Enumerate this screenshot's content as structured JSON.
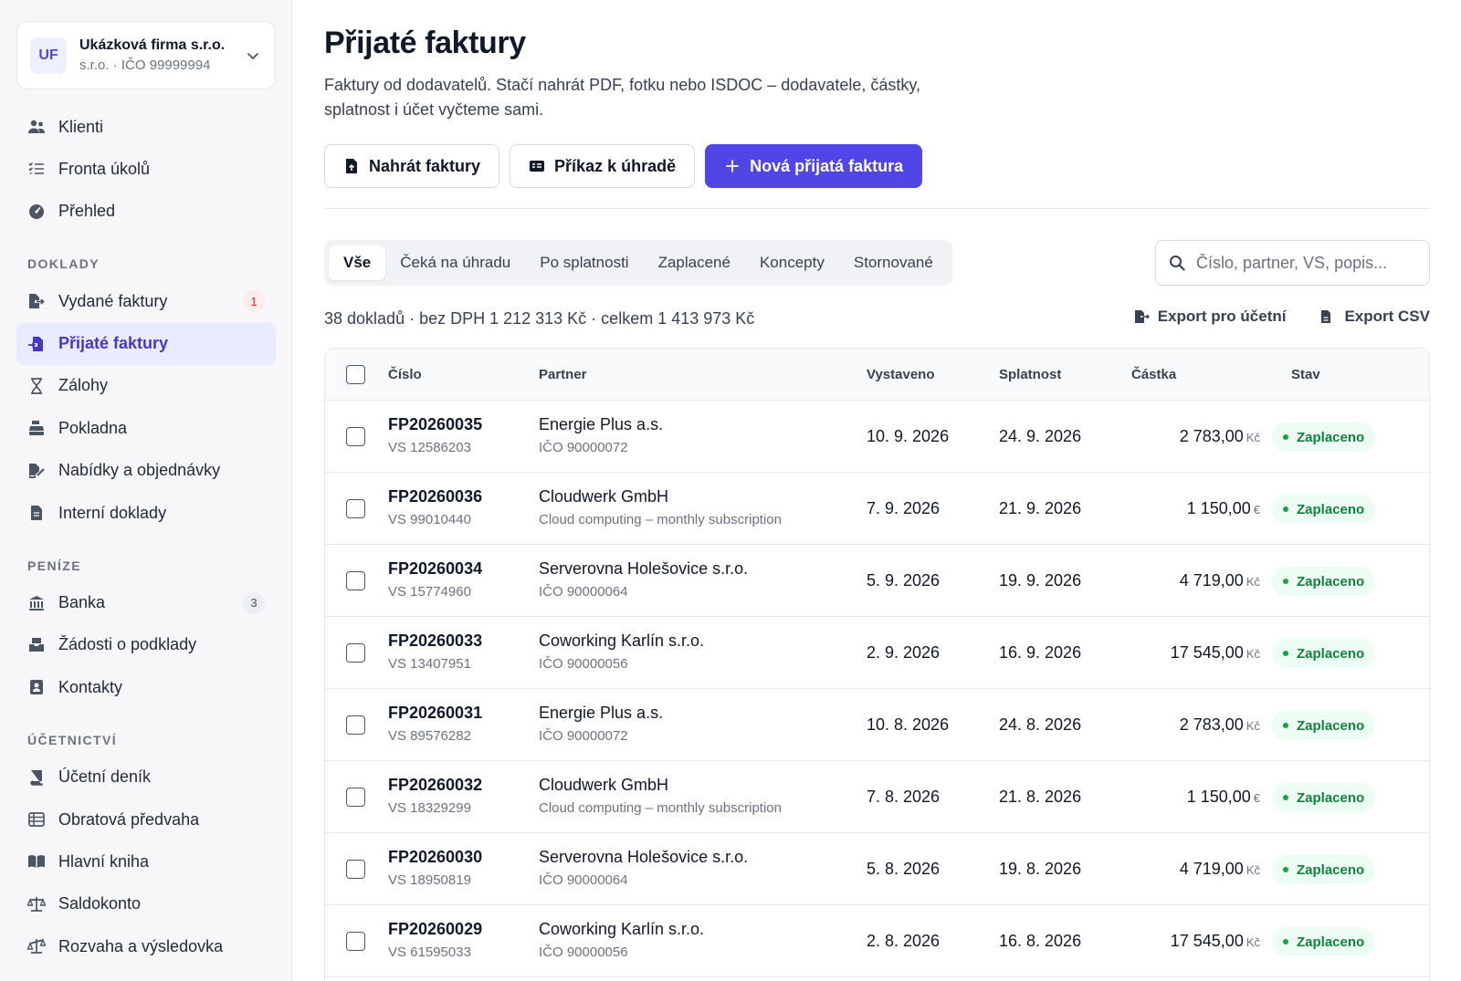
{
  "company": {
    "initials": "UF",
    "name": "Ukázková firma s.r.o.",
    "sub": "s.r.o. · IČO 99999994"
  },
  "nav": {
    "top": [
      {
        "label": "Klienti",
        "icon": "users-icon"
      },
      {
        "label": "Fronta úkolů",
        "icon": "task-list-icon"
      },
      {
        "label": "Přehled",
        "icon": "dashboard-gauge-icon"
      }
    ],
    "doklady_title": "DOKLADY",
    "doklady": [
      {
        "label": "Vydané faktury",
        "icon": "file-export-icon",
        "badge": "1"
      },
      {
        "label": "Přijaté faktury",
        "icon": "file-import-icon",
        "active": true
      },
      {
        "label": "Zálohy",
        "icon": "hourglass-icon"
      },
      {
        "label": "Pokladna",
        "icon": "cash-register-icon"
      },
      {
        "label": "Nabídky a objednávky",
        "icon": "file-signature-icon"
      },
      {
        "label": "Interní doklady",
        "icon": "file-icon"
      }
    ],
    "penize_title": "PENÍZE",
    "penize": [
      {
        "label": "Banka",
        "icon": "bank-icon",
        "badge": "3"
      },
      {
        "label": "Žádosti o podklady",
        "icon": "inbox-request-icon"
      },
      {
        "label": "Kontakty",
        "icon": "contact-card-icon"
      }
    ],
    "ucetnictvi_title": "ÚČETNICTVÍ",
    "ucetnictvi": [
      {
        "label": "Účetní deník",
        "icon": "journal-book-icon"
      },
      {
        "label": "Obratová předvaha",
        "icon": "table-list-icon"
      },
      {
        "label": "Hlavní kniha",
        "icon": "open-book-icon"
      },
      {
        "label": "Saldokonto",
        "icon": "scale-balanced-icon"
      },
      {
        "label": "Rozvaha a výsledovka",
        "icon": "scale-unbalanced-icon"
      }
    ]
  },
  "page": {
    "title": "Přijaté faktury",
    "description": "Faktury od dodavatelů. Stačí nahrát PDF, fotku nebo ISDOC – dodavatele, částky, splatnost i účet vyčteme sami."
  },
  "actions": {
    "upload": "Nahrát faktury",
    "payment_order": "Příkaz k úhradě",
    "new_invoice": "Nová přijatá faktura"
  },
  "tabs": [
    "Vše",
    "Čeká na úhradu",
    "Po splatnosti",
    "Zaplacené",
    "Koncepty",
    "Stornované"
  ],
  "active_tab": "Vše",
  "search": {
    "placeholder": "Číslo, partner, VS, popis...",
    "value": ""
  },
  "summary": "38 dokladů · bez DPH 1 212 313 Kč · celkem 1 413 973 Kč",
  "exports": {
    "accountant": "Export pro účetní",
    "csv": "Export CSV"
  },
  "table": {
    "columns": {
      "number": "Číslo",
      "partner": "Partner",
      "issued": "Vystaveno",
      "due": "Splatnost",
      "amount": "Částka",
      "status": "Stav"
    },
    "rows": [
      {
        "number": "FP20260035",
        "vs": "VS 12586203",
        "partner": "Energie Plus a.s.",
        "sub": "IČO 90000072",
        "issued": "10. 9. 2026",
        "due": "24. 9. 2026",
        "amount": "2 783,00",
        "currency": "Kč",
        "status": "Zaplaceno"
      },
      {
        "number": "FP20260036",
        "vs": "VS 99010440",
        "partner": "Cloudwerk GmbH",
        "sub": "Cloud computing – monthly subscription",
        "issued": "7. 9. 2026",
        "due": "21. 9. 2026",
        "amount": "1 150,00",
        "currency": "€",
        "status": "Zaplaceno"
      },
      {
        "number": "FP20260034",
        "vs": "VS 15774960",
        "partner": "Serverovna Holešovice s.r.o.",
        "sub": "IČO 90000064",
        "issued": "5. 9. 2026",
        "due": "19. 9. 2026",
        "amount": "4 719,00",
        "currency": "Kč",
        "status": "Zaplaceno"
      },
      {
        "number": "FP20260033",
        "vs": "VS 13407951",
        "partner": "Coworking Karlín s.r.o.",
        "sub": "IČO 90000056",
        "issued": "2. 9. 2026",
        "due": "16. 9. 2026",
        "amount": "17 545,00",
        "currency": "Kč",
        "status": "Zaplaceno"
      },
      {
        "number": "FP20260031",
        "vs": "VS 89576282",
        "partner": "Energie Plus a.s.",
        "sub": "IČO 90000072",
        "issued": "10. 8. 2026",
        "due": "24. 8. 2026",
        "amount": "2 783,00",
        "currency": "Kč",
        "status": "Zaplaceno"
      },
      {
        "number": "FP20260032",
        "vs": "VS 18329299",
        "partner": "Cloudwerk GmbH",
        "sub": "Cloud computing – monthly subscription",
        "issued": "7. 8. 2026",
        "due": "21. 8. 2026",
        "amount": "1 150,00",
        "currency": "€",
        "status": "Zaplaceno"
      },
      {
        "number": "FP20260030",
        "vs": "VS 18950819",
        "partner": "Serverovna Holešovice s.r.o.",
        "sub": "IČO 90000064",
        "issued": "5. 8. 2026",
        "due": "19. 8. 2026",
        "amount": "4 719,00",
        "currency": "Kč",
        "status": "Zaplaceno"
      },
      {
        "number": "FP20260029",
        "vs": "VS 61595033",
        "partner": "Coworking Karlín s.r.o.",
        "sub": "IČO 90000056",
        "issued": "2. 8. 2026",
        "due": "16. 8. 2026",
        "amount": "17 545,00",
        "currency": "Kč",
        "status": "Zaplaceno"
      }
    ]
  },
  "colors": {
    "accent": "#4f46e5",
    "active_bg": "#e9ebff",
    "paid_bg": "#ecfdf3",
    "paid_text": "#15803d"
  }
}
